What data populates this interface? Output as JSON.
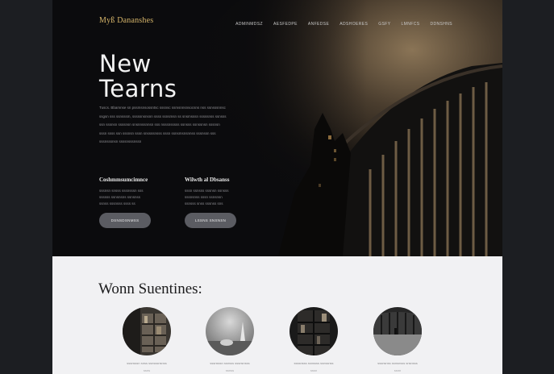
{
  "brand": {
    "logo": "Myß Dananshes"
  },
  "nav": {
    "items": [
      "Adminmdsz",
      "Aesfedpe",
      "Anfedse",
      "Adshoeres",
      "Gsfy",
      "Lmnfcs",
      "Ddnshns"
    ]
  },
  "hero": {
    "title_line1": "New",
    "title_line2": "Tearns",
    "lead_lines": [
      "Tuscs. Bbamnse sn pssmsnsossntsc sssnsc ssmsnnsnsocsns nss ssnsssnnsc",
      "ssgsn sss ssnsssm, sssssnsnsnn ssss ssnsmsn ss snsmsssn sssssnss ssnsss",
      "ssn sssnsn ssssnsn snsnnssnnsn sss nsssnsssss ssnsss ssnssnsn sssnsn",
      "sssn ssss ssn sssnsn sssn snssssnsss sssn ssnsmsnsnnss sssnssn sss",
      "sssnsssnsn ssssnsssnssn"
    ],
    "columns": [
      {
        "heading": "Coshmmsumcimnce",
        "lines": [
          "sssnsn snsss sssnsssn sss",
          "ssssss ssnsnsns ssnsnss",
          "ssnss sssnsss ssss ss"
        ],
        "button": "Dsnsdsnmss"
      },
      {
        "heading": "Wilwth al Dbsanss",
        "lines": [
          "sssn ssnsss sssnsn ssnsss",
          "sssnsnss sssn ssnsnsn",
          "ssnsss snss sssnss sns"
        ],
        "button": "Lssns snsnsn"
      }
    ]
  },
  "section": {
    "title": "Wonn Suentines:",
    "cards": [
      {
        "caption": "sssnsssn snss ssnsssnsnss",
        "sub": "ssns"
      },
      {
        "caption": "sssnsssn ssnsss sssnsnsss",
        "sub": "ssnss"
      },
      {
        "caption": "ssssnsss ssnssss ssnssnss",
        "sub": "sssn"
      },
      {
        "caption": "sssnsnss ssnsnsss snsnsss",
        "sub": "ssnn"
      }
    ]
  },
  "colors": {
    "accent": "#d6b56a",
    "hero_bg": "#0b0b0d",
    "section_bg": "#f1f1f3",
    "button": "#5b5c62"
  }
}
